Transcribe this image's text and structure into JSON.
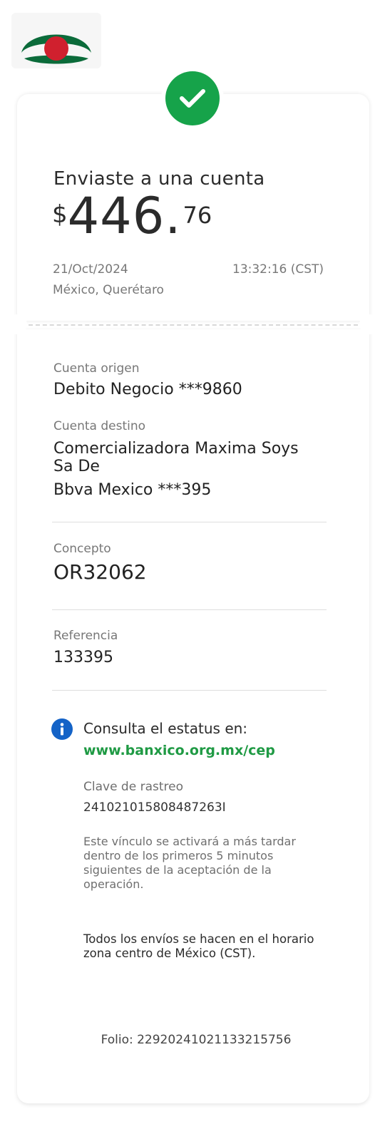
{
  "brand": {
    "logo_icon": "bank-logo-icon",
    "logo_colors": [
      "#0b6b3a",
      "#d0202e"
    ]
  },
  "status": {
    "icon": "checkmark-icon",
    "color": "#16a34a"
  },
  "header": {
    "title": "Enviaste a una cuenta",
    "amount": {
      "currency": "$",
      "integer": "446.",
      "cents": "76"
    },
    "date": "21/Oct/2024",
    "time": "13:32:16 (CST)",
    "location": "México, Querétaro"
  },
  "details": {
    "origin_label": "Cuenta origen",
    "origin_value": "Debito Negocio ***9860",
    "dest_label": "Cuenta destino",
    "dest_line1": "Comercializadora Maxima Soys",
    "dest_line2": "Sa De",
    "dest_line3": "Bbva Mexico ***395",
    "concept_label": "Concepto",
    "concept_value": "OR32062",
    "reference_label": "Referencia",
    "reference_value": "133395"
  },
  "status_info": {
    "icon": "info-icon",
    "title": "Consulta el estatus en:",
    "link": "www.banxico.org.mx/cep",
    "tracking_label": "Clave de rastreo",
    "tracking_value": "241021015808487263I",
    "note": "Este vínculo se activará a más tardar dentro de los primeros 5 minutos siguientes de la aceptación de la operación.",
    "schedule_note": "Todos los envíos se hacen en el horario zona centro de México (CST)."
  },
  "footer": {
    "folio": "Folio: 229202410211332157​56"
  }
}
